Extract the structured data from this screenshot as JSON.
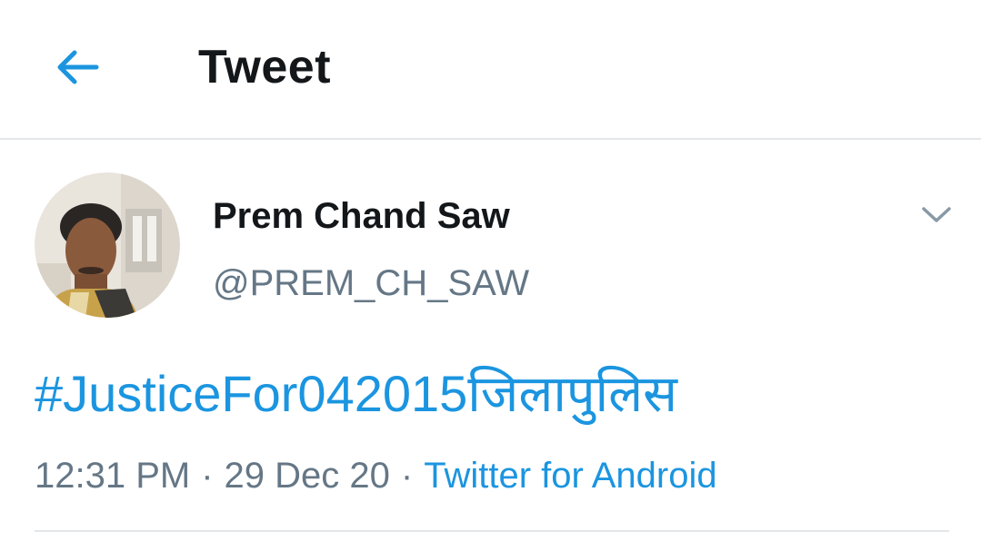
{
  "header": {
    "back_icon": "arrow-left-icon",
    "title": "Tweet"
  },
  "tweet": {
    "author": {
      "display_name": "Prem Chand Saw",
      "handle": "@PREM_CH_SAW",
      "avatar_icon": "user-avatar"
    },
    "menu_icon": "chevron-down-icon",
    "text": "#JusticeFor042015जिलापुलिस",
    "time": "12:31 PM",
    "date": "29 Dec 20",
    "separator": "·",
    "source": "Twitter for Android"
  },
  "colors": {
    "accent": "#1b95e0",
    "text_primary": "#14171a",
    "text_secondary": "#657786",
    "divider": "#e3e6e8"
  }
}
